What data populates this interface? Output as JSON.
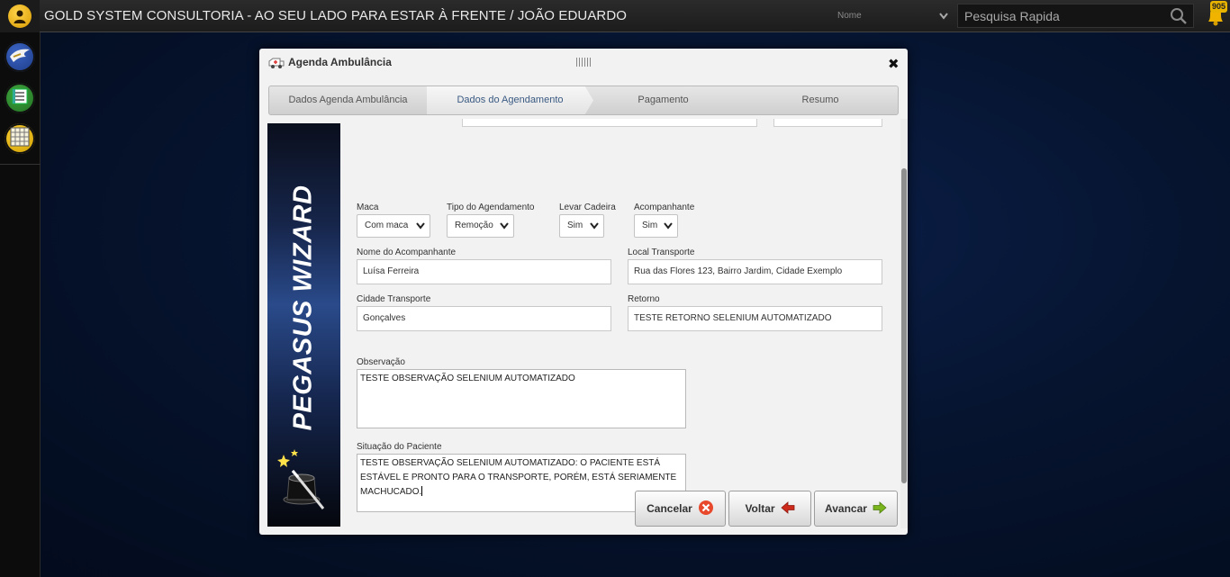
{
  "header": {
    "title": "GOLD SYSTEM CONSULTORIA - AO SEU LADO PARA ESTAR À FRENTE / JOÃO EDUARDO",
    "search_filter": "Nome",
    "search_placeholder": "Pesquisa Rapida",
    "notification_count": "905"
  },
  "sidebar": {
    "items": [
      {
        "icon": "wing-icon",
        "color": "#2c4c9b"
      },
      {
        "icon": "list-icon",
        "color": "#2f8a2f"
      },
      {
        "icon": "calendar-grid-icon",
        "color": "#e0b000"
      }
    ]
  },
  "dialog": {
    "title": "Agenda Ambulância",
    "steps": [
      {
        "label": "Dados Agenda Ambulância"
      },
      {
        "label": "Dados do Agendamento",
        "active": true
      },
      {
        "label": "Pagamento"
      },
      {
        "label": "Resumo"
      }
    ],
    "banner_text": "PEGASUS WIZARD",
    "fields": {
      "maca": {
        "label": "Maca",
        "value": "Com maca"
      },
      "tipo": {
        "label": "Tipo do Agendamento",
        "value": "Remoção"
      },
      "cadeira": {
        "label": "Levar Cadeira",
        "value": "Sim"
      },
      "acompanhante": {
        "label": "Acompanhante",
        "value": "Sim"
      },
      "nome_acompanhante": {
        "label": "Nome do Acompanhante",
        "value": "Luísa Ferreira"
      },
      "local_transporte": {
        "label": "Local Transporte",
        "value": "Rua das Flores 123, Bairro Jardim, Cidade Exemplo"
      },
      "cidade_transporte": {
        "label": "Cidade Transporte",
        "value": "Gonçalves"
      },
      "retorno": {
        "label": "Retorno",
        "value": "TESTE RETORNO SELENIUM AUTOMATIZADO"
      },
      "observacao": {
        "label": "Observação",
        "value": "TESTE OBSERVAÇÃO SELENIUM AUTOMATIZADO"
      },
      "situacao": {
        "label": "Situação do Paciente",
        "value": "TESTE OBSERVAÇÃO SELENIUM AUTOMATIZADO: O PACIENTE ESTÁ ESTÁVEL E PRONTO PARA O TRANSPORTE, PORÉM, ESTÁ SERIAMENTE MACHUCADO."
      }
    },
    "buttons": {
      "cancel": "Cancelar",
      "back": "Voltar",
      "next": "Avancar"
    },
    "colors": {
      "cancel": "#e8482b",
      "back": "#cc2a1a",
      "next": "#7ab51d"
    }
  }
}
